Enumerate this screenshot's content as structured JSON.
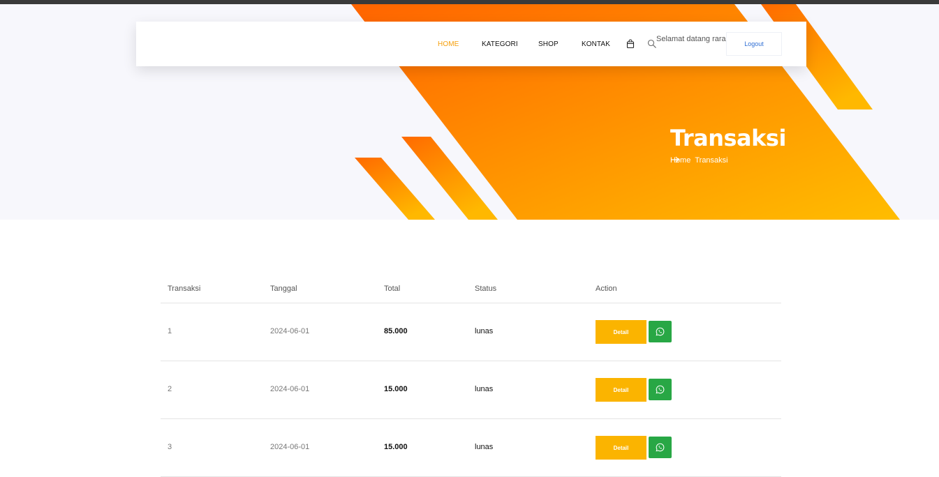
{
  "nav": {
    "items": [
      "HOME",
      "KATEGORI",
      "SHOP",
      "KONTAK"
    ],
    "welcome": "Selamat datang rara",
    "logout": "Logout",
    "cart_icon": "shopping-bag-icon",
    "search_icon": "search-icon"
  },
  "hero": {
    "title": "Transaksi",
    "breadcrumb_home": "Home",
    "breadcrumb_current": "Transaksi"
  },
  "table": {
    "headers": [
      "Transaksi",
      "Tanggal",
      "Total",
      "Status",
      "Action"
    ],
    "rows": [
      {
        "id": "1",
        "date": "2024-06-01",
        "total": "85.000",
        "status": "lunas",
        "detail": "Detail"
      },
      {
        "id": "2",
        "date": "2024-06-01",
        "total": "15.000",
        "status": "lunas",
        "detail": "Detail"
      },
      {
        "id": "3",
        "date": "2024-06-01",
        "total": "15.000",
        "status": "lunas",
        "detail": "Detail"
      }
    ]
  },
  "colors": {
    "accent": "#f59f0b",
    "orange": "#ff6a00",
    "yellow": "#ffbb00",
    "whatsapp": "#28a745"
  }
}
